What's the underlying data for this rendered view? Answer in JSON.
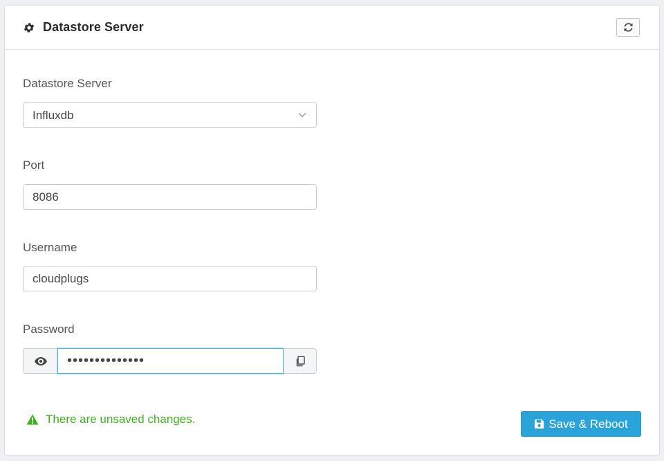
{
  "header": {
    "title": "Datastore Server",
    "icon": "gear-icon",
    "refresh_icon": "refresh-icon"
  },
  "form": {
    "datastore": {
      "label": "Datastore Server",
      "value": "Influxdb"
    },
    "port": {
      "label": "Port",
      "value": "8086"
    },
    "username": {
      "label": "Username",
      "value": "cloudplugs"
    },
    "password": {
      "label": "Password",
      "value": "••••••••••••••",
      "show_icon": "eye-icon",
      "copy_icon": "copy-icon"
    }
  },
  "footer": {
    "warning": "There are unsaved changes.",
    "warning_icon": "warning-triangle-icon",
    "save_label": "Save & Reboot",
    "save_icon": "floppy-disk-icon"
  },
  "colors": {
    "accent": "#29a3d8",
    "warning": "#3db21f",
    "focus": "#46b4e6"
  }
}
